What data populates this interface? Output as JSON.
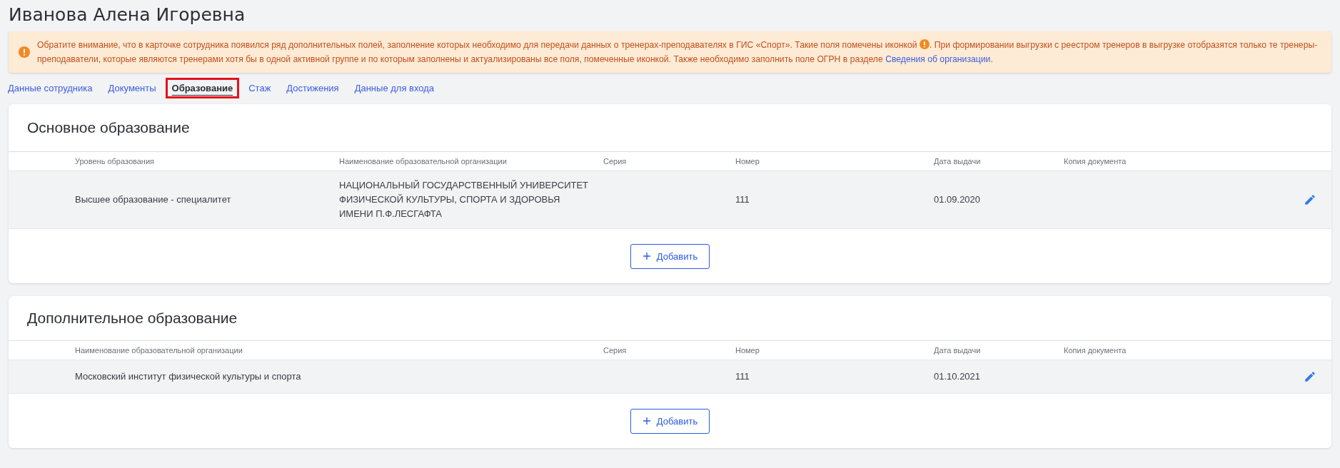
{
  "page_title": "Иванова Алена Игоревна",
  "notice": {
    "text_before": "Обратите внимание, что в карточке сотрудника появился ряд дополнительных полей, заполнение которых необходимо для передачи данных о тренерах-преподавателях в ГИС «Спорт». Такие поля помечены иконкой",
    "text_after": ". При формировании выгрузки с реестром тренеров в выгрузке отобразятся только те тренеры-преподаватели, которые являются тренерами хотя бы в одной активной группе и по которым заполнены и актуализированы все поля, помеченные иконкой. Также необходимо заполнить поле ОГРН в разделе",
    "link": "Сведения об организации",
    "text_end": "."
  },
  "tabs": [
    {
      "label": "Данные сотрудника",
      "selected": false
    },
    {
      "label": "Документы",
      "selected": false
    },
    {
      "label": "Образование",
      "selected": true
    },
    {
      "label": "Стаж",
      "selected": false
    },
    {
      "label": "Достижения",
      "selected": false
    },
    {
      "label": "Данные для входа",
      "selected": false
    }
  ],
  "sections": [
    {
      "title": "Основное образование",
      "columns": [
        "Уровень образования",
        "Наименование образовательной организации",
        "Серия",
        "Номер",
        "Дата выдачи",
        "Копия документа"
      ],
      "rows": [
        {
          "cells": [
            "Высшее образование - специалитет",
            "НАЦИОНАЛЬНЫЙ ГОСУДАРСТВЕННЫЙ УНИВЕРСИТЕТ ФИЗИЧЕСКОЙ КУЛЬТУРЫ, СПОРТА И ЗДОРОВЬЯ ИМЕНИ П.Ф.ЛЕСГАФТА",
            "",
            "111",
            "01.09.2020",
            ""
          ]
        }
      ],
      "add_button": "Добавить"
    },
    {
      "title": "Дополнительное образование",
      "columns": [
        "Наименование образовательной организации",
        "Серия",
        "Номер",
        "Дата выдачи",
        "Копия документа"
      ],
      "rows": [
        {
          "cells": [
            "Московский институт физической культуры и спорта",
            "",
            "111",
            "01.10.2021",
            ""
          ]
        }
      ],
      "add_button": "Добавить"
    }
  ]
}
